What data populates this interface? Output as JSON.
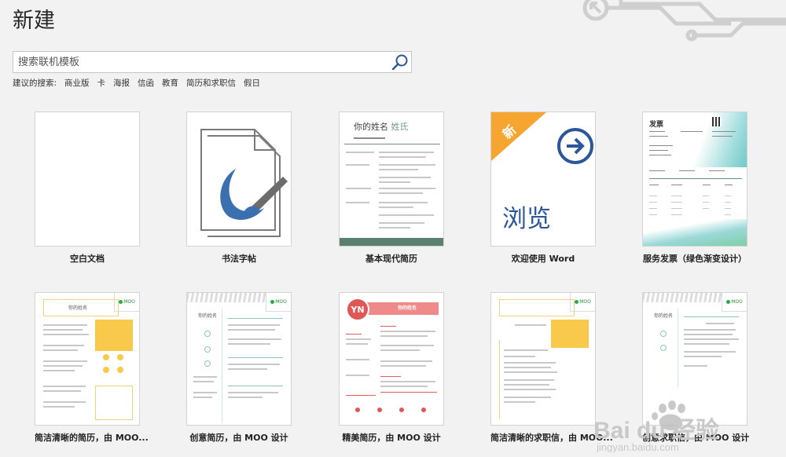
{
  "page_title": "新建",
  "search": {
    "placeholder": "搜索联机模板"
  },
  "suggestions": {
    "label": "建议的搜索:",
    "items": [
      "商业版",
      "卡",
      "海报",
      "信函",
      "教育",
      "简历和求职信",
      "假日"
    ]
  },
  "templates": [
    {
      "label": "空白文档"
    },
    {
      "label": "书法字帖"
    },
    {
      "label": "基本现代简历",
      "name_text": "你的姓名",
      "surname": "姓氏"
    },
    {
      "label": "欢迎使用 Word",
      "badge": "新",
      "big_text": "浏览"
    },
    {
      "label": "服务发票（绿色渐变设计）",
      "doc_title": "发票"
    },
    {
      "label": "简洁清晰的简历，由 MOO...",
      "name_text": "你的姓名",
      "moo": "MOO"
    },
    {
      "label": "创意简历，由 MOO 设计",
      "name_text": "你的姓名",
      "moo": "MOO"
    },
    {
      "label": "精美简历，由 MOO 设计",
      "initials": "YN",
      "name_text": "你的姓名"
    },
    {
      "label": "简洁清晰的求职信，由 MOO...",
      "moo": "MOO"
    },
    {
      "label": "创意求职信，由 MOO 设计",
      "name_text": "你的姓名",
      "moo": "MOO"
    }
  ],
  "watermark": {
    "text": "Bai du 经验",
    "url": "jingyan.baidu.com"
  },
  "colors": {
    "accent": "#2b579a",
    "teal": "#5a8f8a",
    "orange": "#f7a531",
    "red": "#e05757",
    "yellow": "#f8c94a"
  }
}
